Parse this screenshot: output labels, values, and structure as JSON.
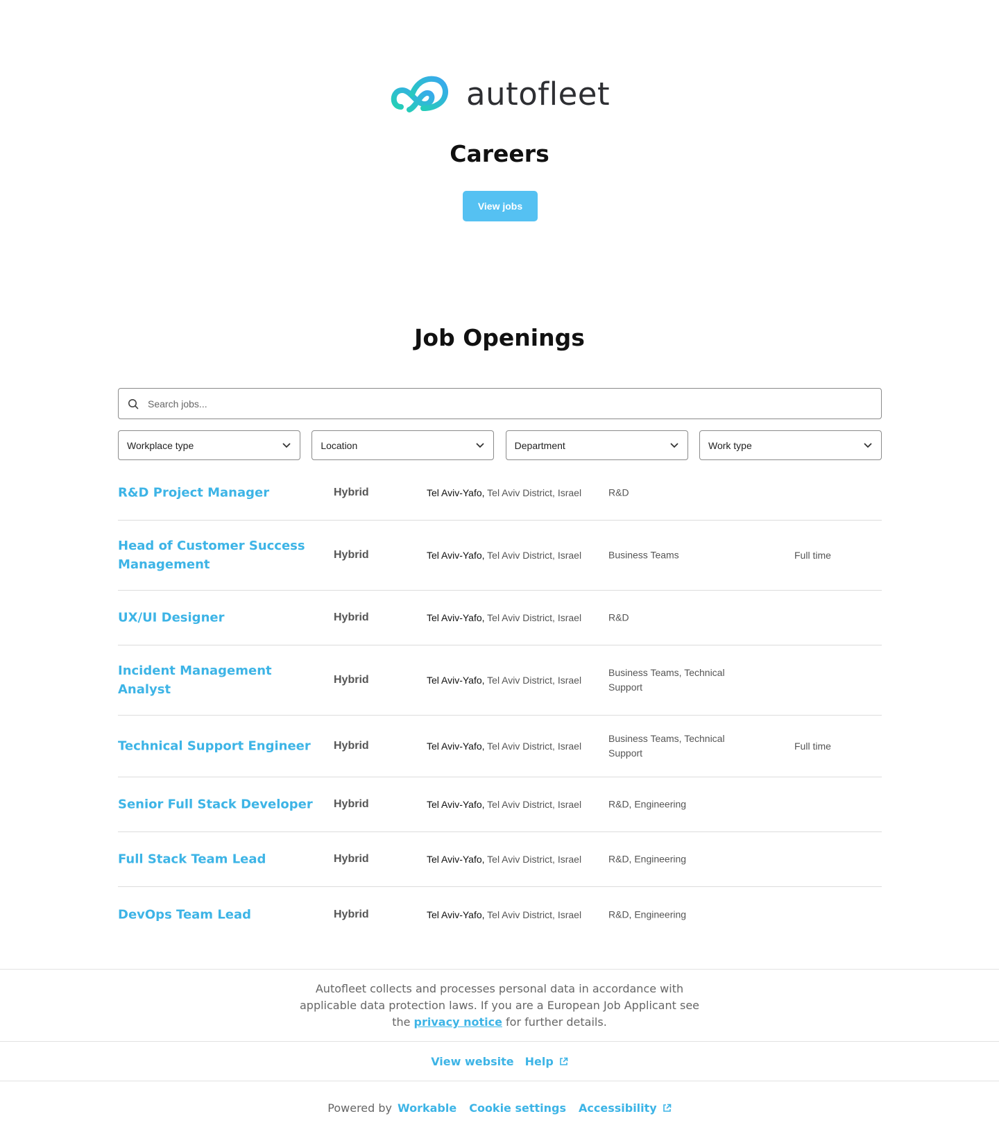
{
  "brand": {
    "name": "autofleet",
    "accent": "#3db4e6",
    "button_color": "#55c1f2"
  },
  "hero": {
    "title": "Careers",
    "cta_label": "View jobs"
  },
  "openings": {
    "title": "Job Openings",
    "search_placeholder": "Search jobs...",
    "filters": [
      {
        "label": "Workplace type",
        "icon": "chevron-down-icon"
      },
      {
        "label": "Location",
        "icon": "chevron-down-icon"
      },
      {
        "label": "Department",
        "icon": "chevron-down-icon"
      },
      {
        "label": "Work type",
        "icon": "chevron-down-icon"
      }
    ],
    "jobs": [
      {
        "title": "R&D Project Manager",
        "workplace": "Hybrid",
        "city": "Tel Aviv-Yafo,",
        "region": " Tel Aviv District, Israel",
        "department": "R&D",
        "work_type": ""
      },
      {
        "title": "Head of Customer Success Management",
        "workplace": "Hybrid",
        "city": "Tel Aviv-Yafo,",
        "region": " Tel Aviv District, Israel",
        "department": "Business Teams",
        "work_type": "Full time"
      },
      {
        "title": "UX/UI Designer",
        "workplace": "Hybrid",
        "city": "Tel Aviv-Yafo,",
        "region": " Tel Aviv District, Israel",
        "department": "R&D",
        "work_type": ""
      },
      {
        "title": "Incident Management Analyst",
        "workplace": "Hybrid",
        "city": "Tel Aviv-Yafo,",
        "region": " Tel Aviv District, Israel",
        "department": "Business Teams, Technical Support",
        "work_type": ""
      },
      {
        "title": "Technical Support Engineer",
        "workplace": "Hybrid",
        "city": "Tel Aviv-Yafo,",
        "region": " Tel Aviv District, Israel",
        "department": "Business Teams, Technical Support",
        "work_type": "Full time"
      },
      {
        "title": "Senior Full Stack Developer",
        "workplace": "Hybrid",
        "city": "Tel Aviv-Yafo,",
        "region": " Tel Aviv District, Israel",
        "department": "R&D, Engineering",
        "work_type": ""
      },
      {
        "title": "Full Stack Team Lead",
        "workplace": "Hybrid",
        "city": "Tel Aviv-Yafo,",
        "region": " Tel Aviv District, Israel",
        "department": "R&D, Engineering",
        "work_type": ""
      },
      {
        "title": "DevOps Team Lead",
        "workplace": "Hybrid",
        "city": "Tel Aviv-Yafo,",
        "region": " Tel Aviv District, Israel",
        "department": "R&D, Engineering",
        "work_type": ""
      }
    ]
  },
  "footer": {
    "notice_before": "Autofleet collects and processes personal data in accordance with applicable data protection laws. If you are a European Job Applicant see the ",
    "notice_link": "privacy notice",
    "notice_after": " for further details.",
    "view_website": "View website",
    "help": "Help",
    "powered_by": "Powered by",
    "workable": "Workable",
    "cookie_settings": "Cookie settings",
    "accessibility": "Accessibility"
  }
}
